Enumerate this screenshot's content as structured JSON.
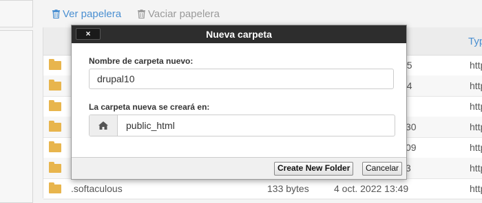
{
  "toolbar": {
    "view_trash": "Ver papelera",
    "empty_trash": "Vaciar papelera"
  },
  "table": {
    "type_header": "Typ",
    "rows": [
      {
        "size_partial": "55",
        "type_partial": "http"
      },
      {
        "size_partial": "44",
        "type_partial": "http"
      },
      {
        "size_partial": "",
        "type_partial": "http"
      },
      {
        "size_partial": "30",
        "type_partial": "http"
      },
      {
        "size_partial": "09",
        "type_partial": "http"
      },
      {
        "size_partial": "3",
        "type_partial": "http"
      },
      {
        "name": ".softaculous",
        "size": "133 bytes",
        "date": "4 oct. 2022 13:49",
        "type_partial": "http"
      }
    ]
  },
  "dialog": {
    "title": "Nueva carpeta",
    "close_label": "×",
    "name_label": "Nombre de carpeta nuevo:",
    "name_value": "drupal10",
    "location_label": "La carpeta nueva se creará en:",
    "location_value": "public_html",
    "create_button": "Create New Folder",
    "cancel_button": "Cancelar"
  }
}
